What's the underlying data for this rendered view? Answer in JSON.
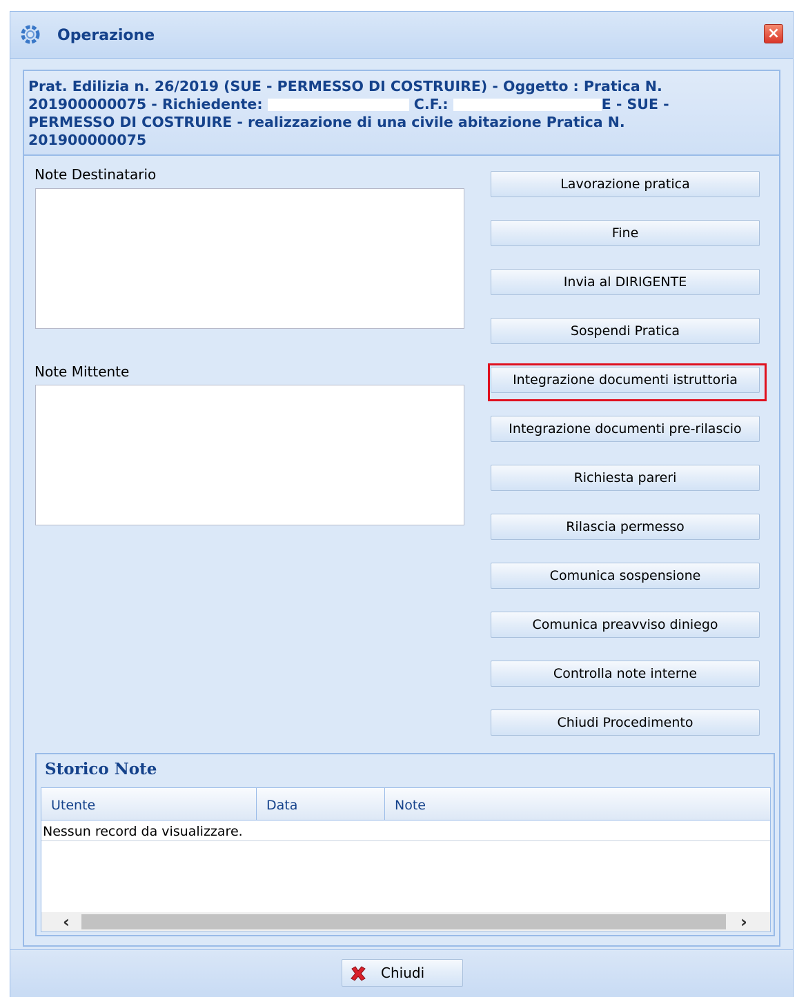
{
  "window": {
    "title": "Operazione",
    "icon": "gear-spin-icon",
    "close_icon": "close-icon"
  },
  "header": {
    "part1": "Prat. Edilizia n. 26/2019 (SUE - PERMESSO DI COSTRUIRE) - Oggetto : Pratica N.",
    "part2a": "201900000075 - Richiedente: ",
    "part2b": " C.F.: ",
    "part2c": "E - SUE -",
    "part3": "PERMESSO DI COSTRUIRE - realizzazione di una civile abitazione Pratica N.",
    "part4": "201900000075"
  },
  "notes": {
    "destinatario_label": "Note Destinatario",
    "destinatario_value": "",
    "mittente_label": "Note Mittente",
    "mittente_value": ""
  },
  "actions": [
    {
      "label": "Lavorazione pratica"
    },
    {
      "label": "Fine"
    },
    {
      "label": "Invia al DIRIGENTE"
    },
    {
      "label": "Sospendi Pratica"
    },
    {
      "label": "Integrazione documenti istruttoria",
      "highlighted": true
    },
    {
      "label": "Integrazione documenti pre-rilascio"
    },
    {
      "label": "Richiesta pareri"
    },
    {
      "label": "Rilascia permesso"
    },
    {
      "label": "Comunica sospensione"
    },
    {
      "label": "Comunica preavviso diniego"
    },
    {
      "label": "Controlla note interne"
    },
    {
      "label": "Chiudi Procedimento"
    }
  ],
  "storico": {
    "title": "Storico Note",
    "columns": [
      "Utente",
      "Data",
      "Note"
    ],
    "empty_message": "Nessun record da visualizzare."
  },
  "footer": {
    "close_label": "Chiudi",
    "close_icon": "red-x-icon"
  },
  "colors": {
    "title_blue": "#15428b",
    "border_blue": "#99bbe8",
    "highlight_red": "#e0101e"
  }
}
